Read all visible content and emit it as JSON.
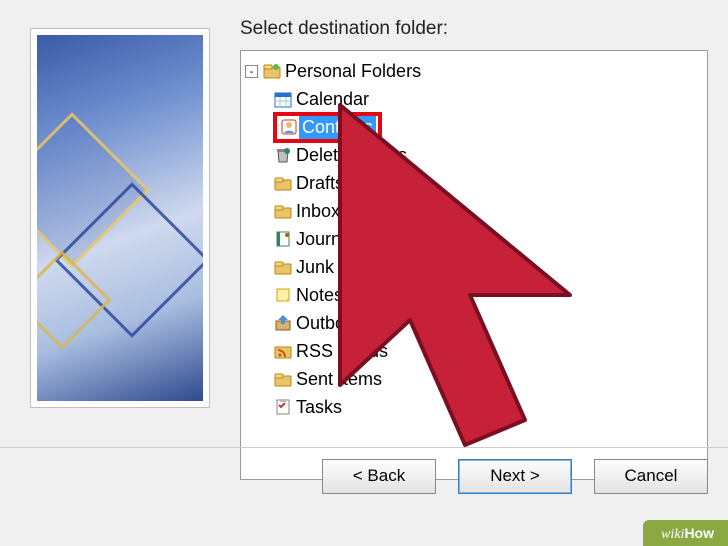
{
  "prompt": "Select destination folder:",
  "tree": {
    "root": {
      "label": "Personal Folders",
      "expand_symbol": "-"
    },
    "children": [
      {
        "label": "Calendar",
        "icon": "calendar-icon"
      },
      {
        "label": "Contacts",
        "icon": "contacts-icon",
        "selected": true,
        "highlighted": true
      },
      {
        "label": "Deleted Items",
        "icon": "trash-icon"
      },
      {
        "label": "Drafts",
        "icon": "folder-icon"
      },
      {
        "label": "Inbox",
        "icon": "folder-icon"
      },
      {
        "label": "Journal",
        "icon": "journal-icon"
      },
      {
        "label": "Junk E-mail",
        "icon": "folder-icon"
      },
      {
        "label": "Notes",
        "icon": "notes-icon"
      },
      {
        "label": "Outbox",
        "icon": "outbox-icon"
      },
      {
        "label": "RSS Feeds",
        "icon": "rss-icon"
      },
      {
        "label": "Sent Items",
        "icon": "folder-icon"
      },
      {
        "label": "Tasks",
        "icon": "tasks-icon"
      }
    ]
  },
  "buttons": {
    "back": "< Back",
    "next": "Next >",
    "cancel": "Cancel"
  },
  "watermark": {
    "prefix": "wiki",
    "suffix": "How"
  },
  "colors": {
    "highlight_border": "#e30613",
    "selection_bg": "#3399ff",
    "cursor_fill": "#c72139"
  }
}
